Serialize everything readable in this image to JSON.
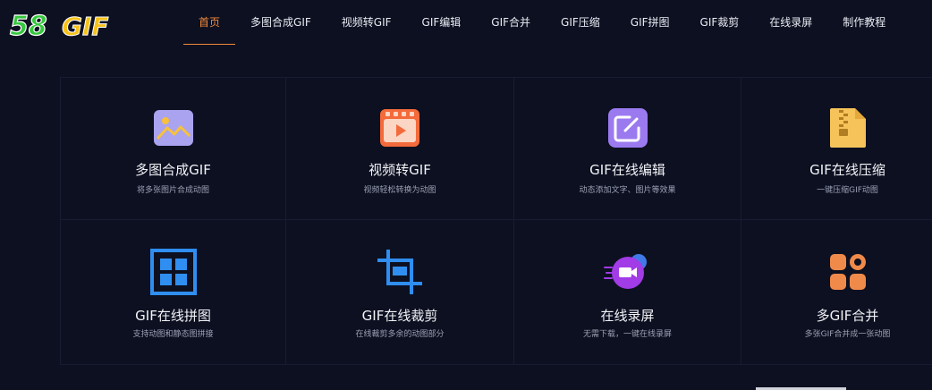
{
  "logo": {
    "number": "58",
    "word": "GIF"
  },
  "nav": [
    {
      "label": "首页",
      "active": true
    },
    {
      "label": "多图合成GIF"
    },
    {
      "label": "视频转GIF"
    },
    {
      "label": "GIF编辑"
    },
    {
      "label": "GIF合并"
    },
    {
      "label": "GIF压缩"
    },
    {
      "label": "GIF拼图"
    },
    {
      "label": "GIF裁剪"
    },
    {
      "label": "在线录屏"
    },
    {
      "label": "制作教程"
    }
  ],
  "tools": [
    {
      "title": "多图合成GIF",
      "desc": "将多张图片合成动图",
      "icon": "image-icon"
    },
    {
      "title": "视频转GIF",
      "desc": "视频轻松转换为动图",
      "icon": "video-icon"
    },
    {
      "title": "GIF在线编辑",
      "desc": "动态添加文字、图片等效果",
      "icon": "edit-icon"
    },
    {
      "title": "GIF在线压缩",
      "desc": "一键压缩GIF动图",
      "icon": "zip-file-icon"
    },
    {
      "title": "GIF在线拼图",
      "desc": "支持动图和静态图拼接",
      "icon": "grid-icon"
    },
    {
      "title": "GIF在线裁剪",
      "desc": "在线裁剪多余的动图部分",
      "icon": "crop-icon"
    },
    {
      "title": "在线录屏",
      "desc": "无需下载，一键在线录屏",
      "icon": "screen-record-icon"
    },
    {
      "title": "多GIF合并",
      "desc": "多张GIF合并成一张动图",
      "icon": "merge-icon"
    }
  ],
  "colors": {
    "accent": "#f08a3c",
    "background": "#0d1021"
  }
}
